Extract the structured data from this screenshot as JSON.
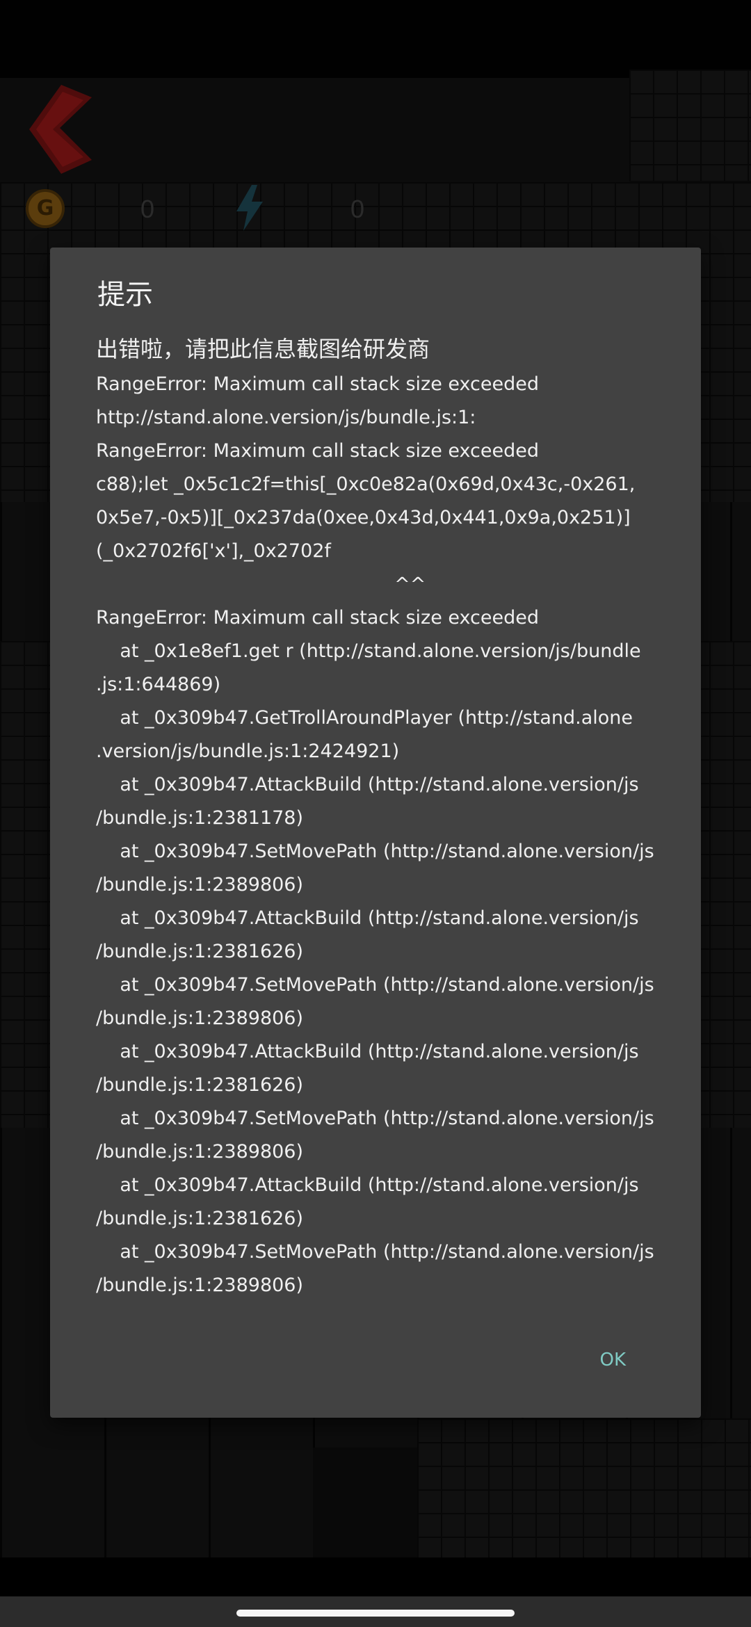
{
  "game": {
    "gold_value": "0",
    "energy_value": "0",
    "coin_icon_letter": "G",
    "icons": {
      "back": "back-arrow-icon",
      "coin": "coin-icon",
      "energy": "lightning-bolt-icon"
    },
    "colors": {
      "back_arrow": "#8a1616",
      "bolt": "#1c4450"
    }
  },
  "dialog": {
    "title": "提示",
    "message_first_line": "出错啦，请把此信息截图给研发商",
    "message_body": "RangeError: Maximum call stack size exceeded\nhttp://stand.alone.version/js/bundle.js:1:\nRangeError: Maximum call stack size exceeded\nc88);let _0x5c1c2f=this[_0xc0e82a(0x69d,0x43c,-0x261,\n0x5e7,-0x5)][_0x237da(0xee,0x43d,0x441,0x9a,0x251)]\n(_0x2702f6['x'],_0x2702f\n                                                  ^^\nRangeError: Maximum call stack size exceeded\n    at _0x1e8ef1.get r (http://stand.alone.version/js/bundle\n.js:1:644869)\n    at _0x309b47.GetTrollAroundPlayer (http://stand.alone\n.version/js/bundle.js:1:2424921)\n    at _0x309b47.AttackBuild (http://stand.alone.version/js\n/bundle.js:1:2381178)\n    at _0x309b47.SetMovePath (http://stand.alone.version/js\n/bundle.js:1:2389806)\n    at _0x309b47.AttackBuild (http://stand.alone.version/js\n/bundle.js:1:2381626)\n    at _0x309b47.SetMovePath (http://stand.alone.version/js\n/bundle.js:1:2389806)\n    at _0x309b47.AttackBuild (http://stand.alone.version/js\n/bundle.js:1:2381626)\n    at _0x309b47.SetMovePath (http://stand.alone.version/js\n/bundle.js:1:2389806)\n    at _0x309b47.AttackBuild (http://stand.alone.version/js\n/bundle.js:1:2381626)\n    at _0x309b47.SetMovePath (http://stand.alone.version/js\n/bundle.js:1:2389806)",
    "ok_label": "OK",
    "colors": {
      "background": "#424242",
      "text": "#f0f0f0",
      "accent": "#80cbc4"
    }
  }
}
